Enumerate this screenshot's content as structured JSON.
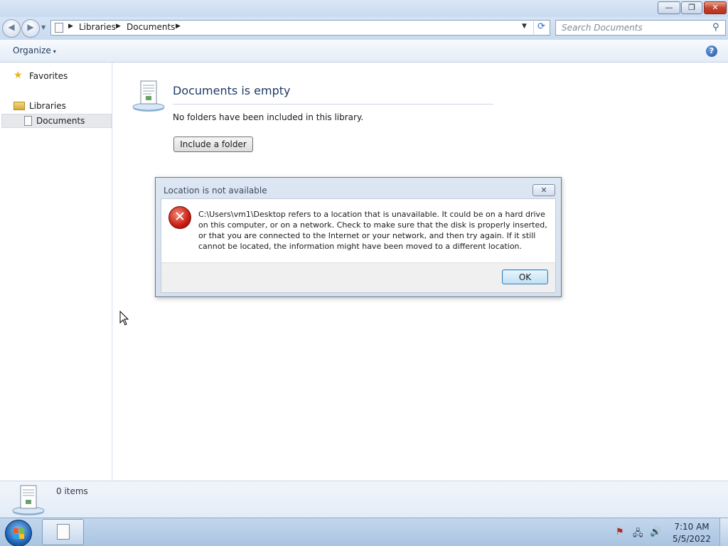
{
  "window": {
    "minimize_glyph": "—",
    "maximize_glyph": "❐",
    "close_glyph": "✕"
  },
  "navigation": {
    "back_glyph": "◀",
    "forward_glyph": "▶",
    "history_glyph": "▼"
  },
  "address": {
    "crumbs": [
      "Libraries",
      "Documents"
    ],
    "separator_glyph": "▶",
    "dropdown_glyph": "▼",
    "refresh_glyph": "⟳"
  },
  "search": {
    "placeholder": "Search Documents",
    "icon": "search-icon",
    "glyph": "⚲"
  },
  "toolbar": {
    "organize_label": "Organize",
    "organize_caret": "▾",
    "help_glyph": "?"
  },
  "nav_pane": {
    "favorites_label": "Favorites",
    "favorites_glyph": "★",
    "libraries_label": "Libraries",
    "documents_label": "Documents",
    "selected": "Documents"
  },
  "content": {
    "title": "Documents is empty",
    "message": "No folders have been included in this library.",
    "include_button_label": "Include a folder"
  },
  "dialog": {
    "title": "Location is not available",
    "close_glyph": "✕",
    "error_glyph": "✕",
    "message": "C:\\Users\\vm1\\Desktop refers to a location that is unavailable. It could be on a hard drive on this computer, or on a network. Check to make sure that the disk is properly inserted, or that you are connected to the Internet or your network, and then try again. If it still cannot be located, the information might have been moved to a different location.",
    "ok_label": "OK"
  },
  "details_pane": {
    "items_count": "0 items"
  },
  "taskbar": {
    "tray_flag_glyph": "⚑",
    "tray_network_glyph": "🖧",
    "tray_volume_glyph": "🔊",
    "time": "7:10 AM",
    "date": "5/5/2022"
  },
  "colors": {
    "title_text": "#1e3a65",
    "error_red": "#c81e12",
    "accent_blue": "#3c7fb1"
  }
}
